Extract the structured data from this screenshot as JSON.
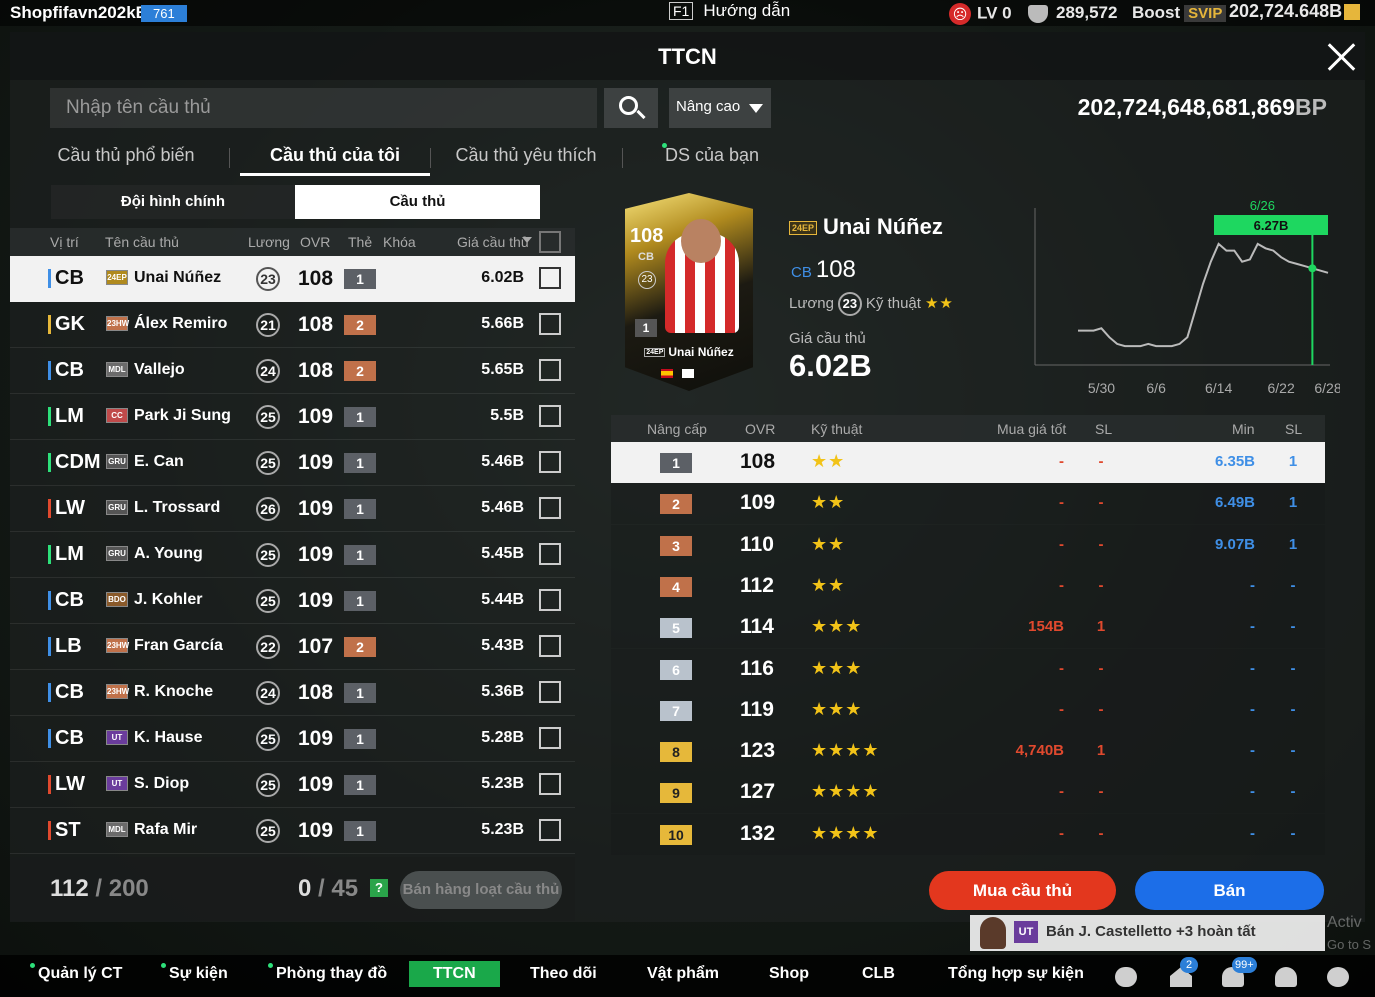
{
  "topbar": {
    "username": "Shopfifavn202kB",
    "user_badge": "761",
    "help_key": "F1",
    "help_label": "Hướng dẫn",
    "level": "LV 0",
    "coins": "289,572",
    "boost_label": "Boost",
    "boost_tier": "SVIP",
    "bp_balance": "202,724.648B"
  },
  "window": {
    "title": "TTCN"
  },
  "search": {
    "placeholder": "Nhập tên cầu thủ",
    "advanced_label": "Nâng cao",
    "bp_total": "202,724,648,681,869",
    "bp_unit": "BP"
  },
  "tabs": [
    {
      "label": "Cầu thủ phổ biến"
    },
    {
      "label": "Cầu thủ của tôi"
    },
    {
      "label": "Cầu thủ yêu thích"
    },
    {
      "label": "DS của bạn"
    }
  ],
  "subtabs": [
    {
      "label": "Đội hình chính"
    },
    {
      "label": "Cầu thủ"
    }
  ],
  "list": {
    "headers": {
      "position": "Vị trí",
      "name": "Tên cầu thủ",
      "wage": "Lương",
      "ovr": "OVR",
      "card": "Thẻ",
      "lock": "Khóa",
      "price": "Giá cầu thủ"
    },
    "players": [
      {
        "pos": "CB",
        "season": "24EP",
        "name": "Unai Núñez",
        "wage": "23",
        "ovr": "108",
        "lvl": "1",
        "price": "6.02B"
      },
      {
        "pos": "GK",
        "season": "23HW",
        "name": "Álex Remiro",
        "wage": "21",
        "ovr": "108",
        "lvl": "2",
        "price": "5.66B"
      },
      {
        "pos": "CB",
        "season": "MDL",
        "name": "Vallejo",
        "wage": "24",
        "ovr": "108",
        "lvl": "2",
        "price": "5.65B"
      },
      {
        "pos": "LM",
        "season": "CC",
        "name": "Park Ji Sung",
        "wage": "25",
        "ovr": "109",
        "lvl": "1",
        "price": "5.5B"
      },
      {
        "pos": "CDM",
        "season": "GRU",
        "name": "E. Can",
        "wage": "25",
        "ovr": "109",
        "lvl": "1",
        "price": "5.46B"
      },
      {
        "pos": "LW",
        "season": "GRU",
        "name": "L. Trossard",
        "wage": "26",
        "ovr": "109",
        "lvl": "1",
        "price": "5.46B"
      },
      {
        "pos": "LM",
        "season": "GRU",
        "name": "A. Young",
        "wage": "25",
        "ovr": "109",
        "lvl": "1",
        "price": "5.45B"
      },
      {
        "pos": "CB",
        "season": "BDO",
        "name": "J. Kohler",
        "wage": "25",
        "ovr": "109",
        "lvl": "1",
        "price": "5.44B"
      },
      {
        "pos": "LB",
        "season": "23HW",
        "name": "Fran García",
        "wage": "22",
        "ovr": "107",
        "lvl": "2",
        "price": "5.43B"
      },
      {
        "pos": "CB",
        "season": "23HW",
        "name": "R. Knoche",
        "wage": "24",
        "ovr": "108",
        "lvl": "1",
        "price": "5.36B"
      },
      {
        "pos": "CB",
        "season": "UT",
        "name": "K. Hause",
        "wage": "25",
        "ovr": "109",
        "lvl": "1",
        "price": "5.28B"
      },
      {
        "pos": "LW",
        "season": "UT",
        "name": "S. Diop",
        "wage": "25",
        "ovr": "109",
        "lvl": "1",
        "price": "5.23B"
      },
      {
        "pos": "ST",
        "season": "MDL",
        "name": "Rafa Mir",
        "wage": "25",
        "ovr": "109",
        "lvl": "1",
        "price": "5.23B"
      }
    ],
    "footer": {
      "count": "112",
      "capacity": "/ 200",
      "selected": "0",
      "selected_max": "/ 45",
      "help": "?",
      "bulk_sell": "Bán hàng loạt cầu thủ"
    }
  },
  "detail": {
    "card_ovr": "108",
    "card_pos": "CB",
    "card_wage": "23",
    "card_lvl": "1",
    "card_season": "24EP",
    "card_name": "Unai Núñez",
    "season": "24EP",
    "name": "Unai Núñez",
    "pos": "CB",
    "ovr": "108",
    "wage_label": "Lương",
    "wage": "23",
    "skill_label": "Kỹ thuật",
    "skill_stars": "★★",
    "price_label": "Giá cầu thủ",
    "price": "6.02B"
  },
  "chart_data": {
    "type": "line",
    "x": [
      "5/27",
      "5/28",
      "5/29",
      "5/30",
      "5/31",
      "6/1",
      "6/2",
      "6/3",
      "6/4",
      "6/5",
      "6/6",
      "6/7",
      "6/8",
      "6/9",
      "6/10",
      "6/11",
      "6/12",
      "6/13",
      "6/14",
      "6/15",
      "6/16",
      "6/17",
      "6/18",
      "6/19",
      "6/20",
      "6/21",
      "6/22",
      "6/23",
      "6/24",
      "6/25",
      "6/26",
      "6/27",
      "6/28"
    ],
    "values": [
      5.91,
      5.91,
      5.91,
      5.92,
      5.88,
      5.85,
      5.84,
      5.84,
      5.84,
      5.85,
      5.84,
      5.84,
      5.84,
      5.85,
      5.88,
      6.0,
      6.12,
      6.22,
      6.3,
      6.27,
      6.27,
      6.22,
      6.23,
      6.3,
      6.28,
      6.27,
      6.24,
      6.22,
      6.21,
      6.2,
      6.19,
      6.18,
      6.17
    ],
    "x_tick_labels": [
      "5/30",
      "6/6",
      "6/14",
      "6/22",
      "6/28"
    ],
    "highlight": {
      "x": "6/26",
      "value": "6.27B"
    },
    "grid": false
  },
  "upgrades": {
    "headers": {
      "level": "Nâng cấp",
      "ovr": "OVR",
      "skill": "Kỹ thuật",
      "best_buy": "Mua giá tốt",
      "sl_buy": "SL",
      "min": "Min",
      "sl_min": "SL"
    },
    "rows": [
      {
        "lvl": "1",
        "ovr": "108",
        "stars": "★★",
        "buy": "-",
        "sl1": "-",
        "min": "6.35B",
        "sl2": "1"
      },
      {
        "lvl": "2",
        "ovr": "109",
        "stars": "★★",
        "buy": "-",
        "sl1": "-",
        "min": "6.49B",
        "sl2": "1"
      },
      {
        "lvl": "3",
        "ovr": "110",
        "stars": "★★",
        "buy": "-",
        "sl1": "-",
        "min": "9.07B",
        "sl2": "1"
      },
      {
        "lvl": "4",
        "ovr": "112",
        "stars": "★★",
        "buy": "-",
        "sl1": "-",
        "min": "-",
        "sl2": "-"
      },
      {
        "lvl": "5",
        "ovr": "114",
        "stars": "★★★",
        "buy": "154B",
        "sl1": "1",
        "min": "-",
        "sl2": "-"
      },
      {
        "lvl": "6",
        "ovr": "116",
        "stars": "★★★",
        "buy": "-",
        "sl1": "-",
        "min": "-",
        "sl2": "-"
      },
      {
        "lvl": "7",
        "ovr": "119",
        "stars": "★★★",
        "buy": "-",
        "sl1": "-",
        "min": "-",
        "sl2": "-"
      },
      {
        "lvl": "8",
        "ovr": "123",
        "stars": "★★★★",
        "buy": "4,740B",
        "sl1": "1",
        "min": "-",
        "sl2": "-"
      },
      {
        "lvl": "9",
        "ovr": "127",
        "stars": "★★★★",
        "buy": "-",
        "sl1": "-",
        "min": "-",
        "sl2": "-"
      },
      {
        "lvl": "10",
        "ovr": "132",
        "stars": "★★★★",
        "buy": "-",
        "sl1": "-",
        "min": "-",
        "sl2": "-"
      }
    ]
  },
  "actions": {
    "buy": "Mua cầu thủ",
    "sell": "Bán"
  },
  "toast": {
    "badge": "UT",
    "message": "Bán J. Castelletto +3 hoàn tất"
  },
  "activate": {
    "line1": "Activ",
    "line2": "Go to S"
  },
  "bottom_nav": [
    {
      "label": "Quản lý CT"
    },
    {
      "label": "Sự kiện"
    },
    {
      "label": "Phòng thay đồ"
    },
    {
      "label": "TTCN"
    },
    {
      "label": "Theo dõi"
    },
    {
      "label": "Vật phẩm"
    },
    {
      "label": "Shop"
    },
    {
      "label": "CLB"
    },
    {
      "label": "Tổng hợp sự kiện"
    }
  ],
  "bottom_icons": {
    "home_badge": "2",
    "bell_badge": "99+"
  },
  "colors": {
    "lvl1": "#5c6066",
    "lvl2": "#c0714a",
    "lvl3": "#c0714a",
    "lvl4": "#c0714a",
    "lvl5": "#b9c2cc",
    "lvl6": "#b9c2cc",
    "lvl7": "#b9c2cc",
    "lvl8": "#e6b83a",
    "lvl9": "#e6b83a",
    "lvl10": "#e6b83a",
    "buy_red": "#e3371e",
    "sell_blue": "#1c6ee8",
    "active_tab_green": "#1aa84a"
  }
}
